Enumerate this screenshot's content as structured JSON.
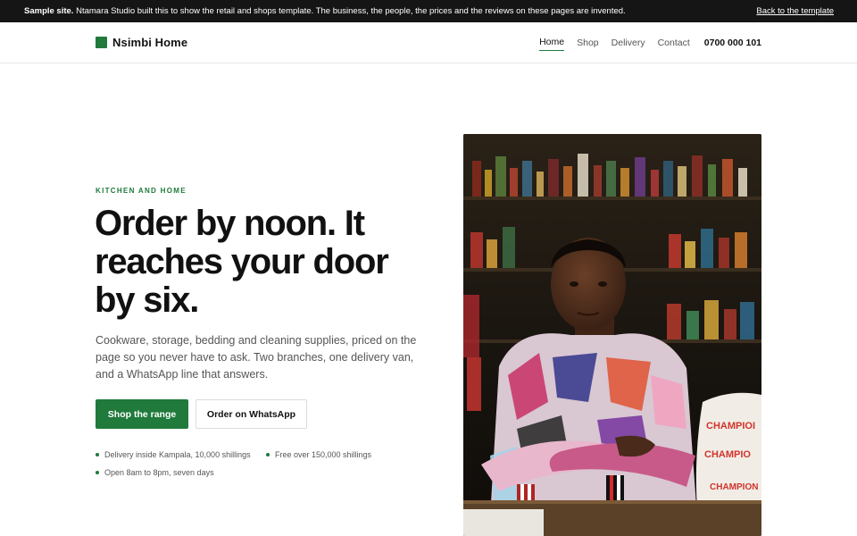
{
  "notice": {
    "label": "Sample site.",
    "message": "Ntamara Studio built this to show the retail and shops template. The business, the people, the prices and the reviews on these pages are invented.",
    "back_link": "Back to the template"
  },
  "header": {
    "brand": "Nsimbi Home",
    "nav": [
      {
        "label": "Home",
        "active": true
      },
      {
        "label": "Shop",
        "active": false
      },
      {
        "label": "Delivery",
        "active": false
      },
      {
        "label": "Contact",
        "active": false
      }
    ],
    "phone": "0700 000 101"
  },
  "hero": {
    "eyebrow": "KITCHEN AND HOME",
    "headline": "Order by noon. It reaches your door by six.",
    "lede": "Cookware, storage, bedding and cleaning supplies, priced on the page so you never have to ask. Two branches, one delivery van, and a WhatsApp line that answers.",
    "primary_button": "Shop the range",
    "secondary_button": "Order on WhatsApp",
    "facts": [
      "Delivery inside Kampala, 10,000 shillings",
      "Free over 150,000 shillings",
      "Open 8am to 8pm, seven days"
    ],
    "image_sack_text": [
      "CHAMPIOI",
      "CHAMPIO",
      "CHAMPION"
    ]
  },
  "colors": {
    "accent": "#1f7a3b",
    "notice_bg": "#151515"
  }
}
